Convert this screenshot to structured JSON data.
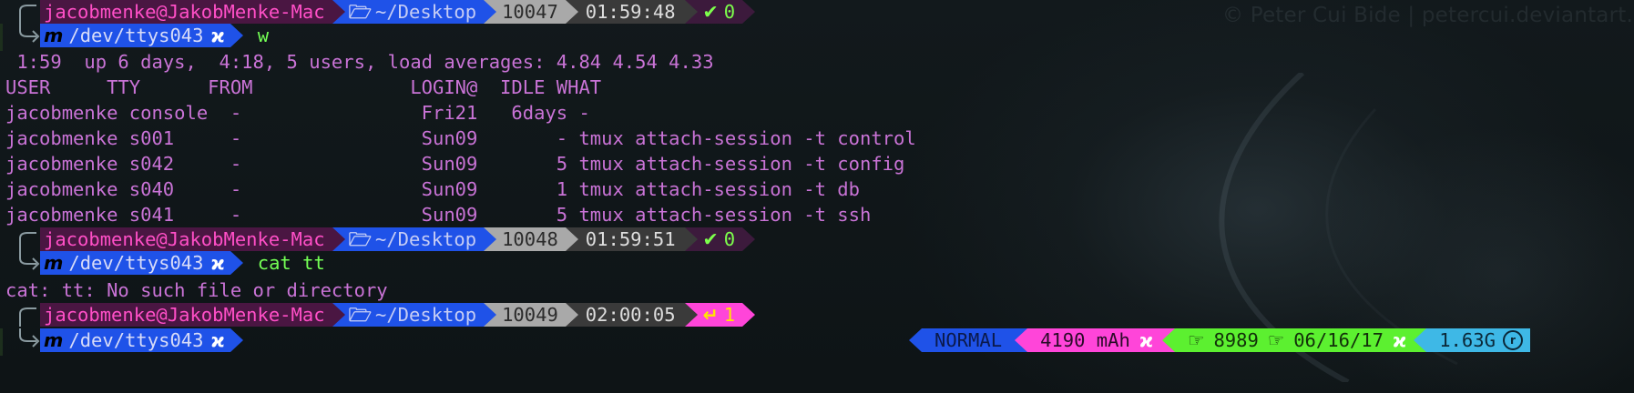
{
  "watermark": "© Peter Cui Bide | petercui.deviantart.co",
  "prompts": [
    {
      "user": "jacobmenke@JakobMenke-Mac",
      "dir": "~/Desktop",
      "hist": "10047",
      "time": "01:59:48",
      "status": "0",
      "status_kind": "ok",
      "tty": "/dev/ttys043",
      "command": "w"
    },
    {
      "user": "jacobmenke@JakobMenke-Mac",
      "dir": "~/Desktop",
      "hist": "10048",
      "time": "01:59:51",
      "status": "0",
      "status_kind": "ok",
      "tty": "/dev/ttys043",
      "command": "cat tt"
    },
    {
      "user": "jacobmenke@JakobMenke-Mac",
      "dir": "~/Desktop",
      "hist": "10049",
      "time": "02:00:05",
      "status": "1",
      "status_kind": "error",
      "tty": "/dev/ttys043",
      "command": ""
    }
  ],
  "w_output": {
    "uptime_line": " 1:59  up 6 days,  4:18, 5 users, load averages: 4.84 4.54 4.33",
    "header": "USER     TTY      FROM              LOGIN@  IDLE WHAT",
    "rows": [
      "jacobmenke console  -                Fri21   6days -",
      "jacobmenke s001     -                Sun09       - tmux attach-session -t control",
      "jacobmenke s042     -                Sun09       5 tmux attach-session -t config",
      "jacobmenke s040     -                Sun09       1 tmux attach-session -t db",
      "jacobmenke s041     -                Sun09       5 tmux attach-session -t ssh"
    ]
  },
  "cat_error": "cat: tt: No such file or directory",
  "status_bar": {
    "mode": "NORMAL",
    "battery": "4190 mAh",
    "count": "8989",
    "date": "06/16/17",
    "memory": "1.63G"
  },
  "icons": {
    "folder": "folder-open-icon",
    "check": "checkmark-icon",
    "return": "return-arrow-icon",
    "tty_logo": "m-logo-icon",
    "tty_sep": "xing-icon",
    "hand": "hand-icon",
    "clock": "clock-icon"
  },
  "colors": {
    "user_bg": "#4a1642",
    "user_fg": "#ff4fc7",
    "dir_bg": "#1f52e8",
    "hist_bg": "#a9a9a9",
    "time_bg": "#3a3a3a",
    "ok_fg": "#7dff4c",
    "err_bg": "#ff45d9",
    "output_fg": "#c973d6",
    "cmd_fg": "#74ff55"
  }
}
